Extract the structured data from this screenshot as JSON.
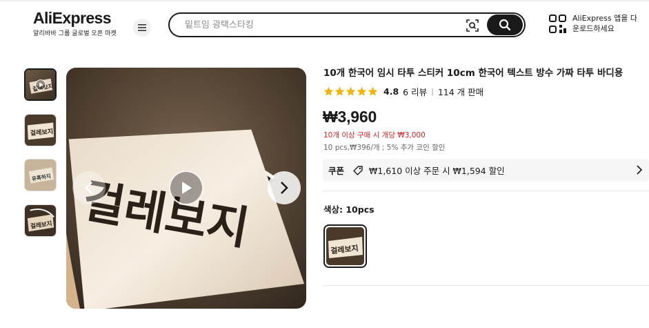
{
  "header": {
    "logo_text": "AliExpress",
    "logo_tagline": "알리바바 그룹 글로벌 오픈 마켓",
    "search_placeholder": "밑트임 광택스타킹",
    "app_download_line1": "AliExpress 앱을 다",
    "app_download_line2": "운로드하세요"
  },
  "gallery": {
    "main_image_text": "걸레보지",
    "thumbnail_count": 4,
    "active_thumbnail": 1
  },
  "product": {
    "title": "10개 한국어 임시 타투 스티커 10cm 한국어 텍스트 방수 가짜 타투 바디용",
    "rating": "4.8",
    "stars_filled": 5,
    "reviews": "6 리뷰",
    "sold": "114 개 판매",
    "price": "₩3,960",
    "bulk_price_note": "10개 이상 구매 시 개당 ₩3,000",
    "bulk_sub_note": "10 pcs,₩396/개 ; 5% 추가 코인 할인",
    "coupon_label": "쿠폰",
    "coupon_text": "₩1,610 이상 주문 시 ₩1,594 할인",
    "color_label": "색상: 10pcs"
  },
  "colors": {
    "text": "#191919",
    "discount_red": "#e02020",
    "star_yellow": "#f5b300"
  }
}
